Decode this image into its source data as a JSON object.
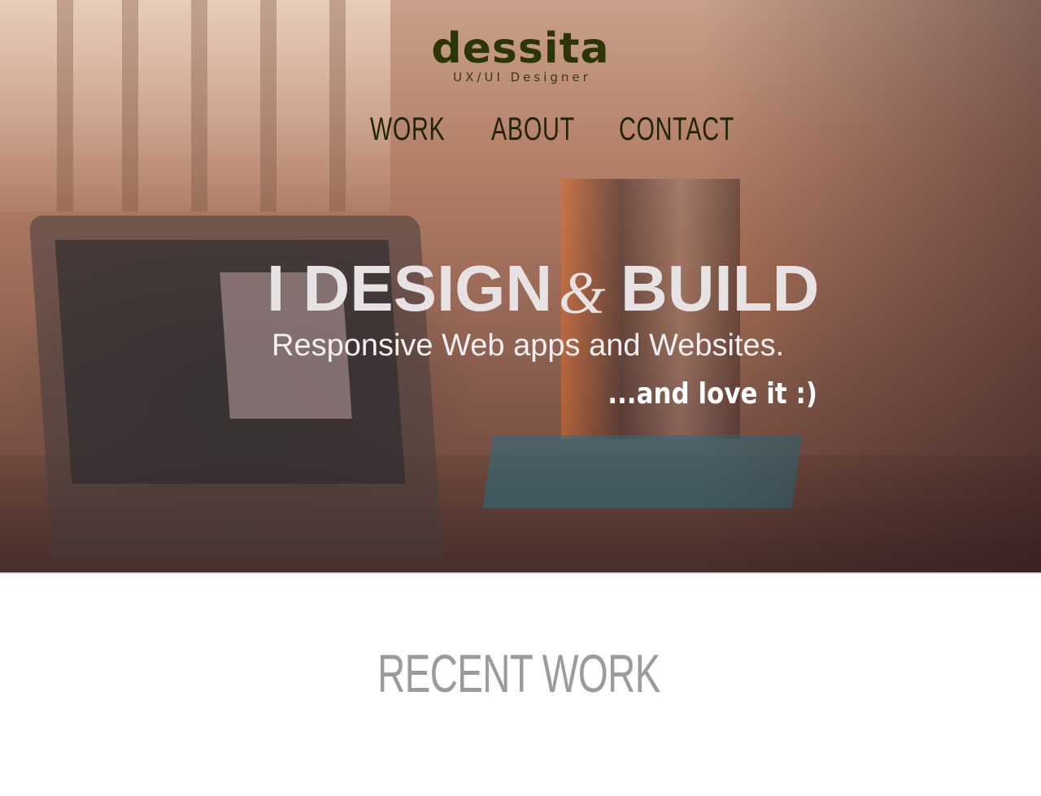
{
  "logo": {
    "name": "dessita",
    "tagline": "UX/UI Designer"
  },
  "nav": {
    "items": [
      {
        "label": "WORK"
      },
      {
        "label": "ABOUT"
      },
      {
        "label": "CONTACT"
      }
    ]
  },
  "hero": {
    "headline_part1": "I DESIGN",
    "headline_amp": "&",
    "headline_part2": "BUILD",
    "subline": "Responsive Web apps and Websites.",
    "tagline": "...and love it :)"
  },
  "recent_work": {
    "title": "RECENT WORK"
  },
  "colors": {
    "logo": "#2b3606",
    "nav": "#1f2408",
    "headline": "#e7e2e4",
    "section_title": "#9b9b9b"
  }
}
